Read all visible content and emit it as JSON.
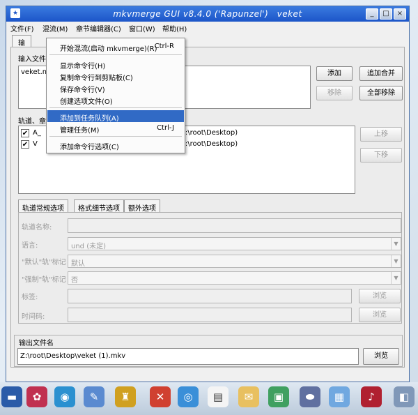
{
  "window": {
    "title": "mkvmerge GUI v8.4.0 ('Rapunzel')",
    "title_suffix": "veket",
    "minimize": "_",
    "maximize": "□",
    "close": "×",
    "app_icon": "app-icon"
  },
  "menubar": [
    "文件(F)",
    "混流(M)",
    "章节编辑器(C)",
    "窗口(W)",
    "帮助(H)"
  ],
  "top_tabs": [
    "输入"
  ],
  "input": {
    "files_label": "输入文件：",
    "file": "veket.mkv",
    "add": "添加",
    "append": "追加合并",
    "remove": "移除",
    "remove_all": "全部移除"
  },
  "tracks": {
    "label": "轨道、章节和标签：",
    "rows": [
      {
        "checked": true,
        "name": "A_",
        "path": "Z:\\root\\Desktop)"
      },
      {
        "checked": true,
        "name": "V",
        "path": "Z:\\root\\Desktop)"
      }
    ],
    "up": "上移",
    "down": "下移"
  },
  "subtabs": [
    "轨道常规选项",
    "格式细节选项",
    "额外选项"
  ],
  "props": {
    "name_label": "轨道名称:",
    "lang_label": "语言:",
    "lang_value": "und (未定)",
    "default_label": "\"默认\"轨\"标记",
    "default_value": "默认",
    "forced_label": "\"强制\"轨\"标记",
    "forced_value": "否",
    "tags_label": "标签:",
    "browse1": "浏览",
    "timecode_label": "时间码:",
    "browse2": "浏览"
  },
  "output": {
    "label": "输出文件名",
    "path": "Z:\\root\\Desktop\\veket (1).mkv",
    "browse": "浏览"
  },
  "menu": {
    "items": [
      {
        "label": "开始混流(启动 mkvmerge)(R)",
        "shortcut": "Ctrl-R"
      },
      {
        "label": "显示命令行(H)",
        "shortcut": ""
      },
      {
        "label": "复制命令行到剪贴板(C)",
        "shortcut": ""
      },
      {
        "label": "保存命令行(V)",
        "shortcut": ""
      },
      {
        "label": "创建选项文件(O)",
        "shortcut": ""
      },
      {
        "label": "添加到任务队列(A)",
        "shortcut": ""
      },
      {
        "label": "管理任务(M)",
        "shortcut": "Ctrl-J"
      },
      {
        "label": "添加命令行选项(C)",
        "shortcut": ""
      }
    ]
  },
  "taskbar": [
    "app-1",
    "app-2",
    "app-3",
    "app-4",
    "app-5",
    "app-6",
    "app-7",
    "app-8",
    "app-9",
    "app-10",
    "app-11",
    "app-12",
    "app-13",
    "app-14",
    "app-15"
  ]
}
